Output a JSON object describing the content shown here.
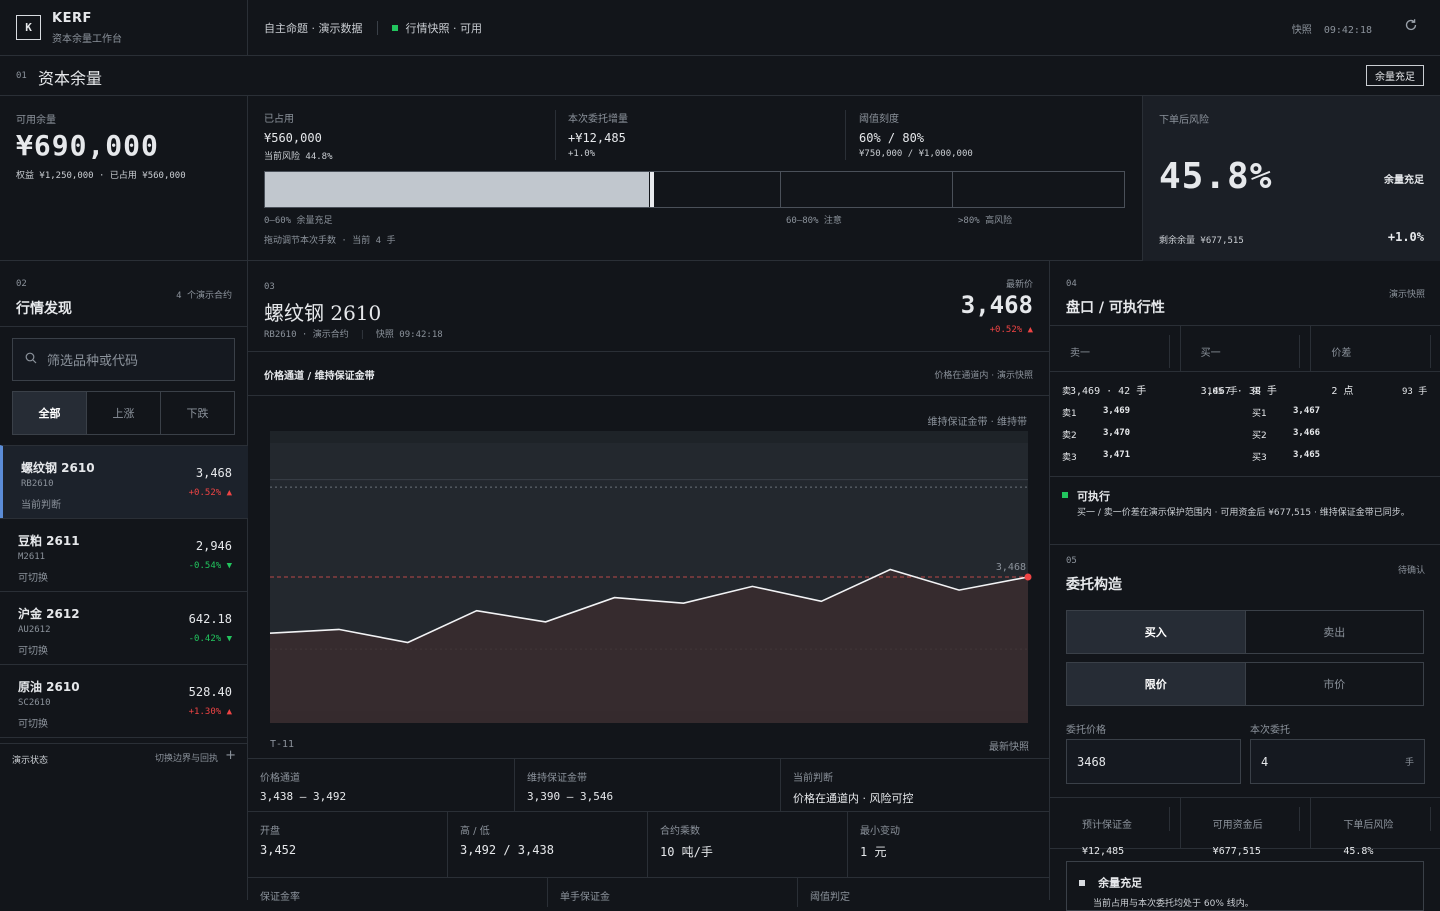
{
  "brand": {
    "logo": "K",
    "name": "KERF",
    "sub": "资本余量工作台"
  },
  "topbar": {
    "crumb_a": "自主命题 · 演示数据",
    "crumb_b": "行情快照 · 可用",
    "snap_label": "快照",
    "snap_time": "09:42:18",
    "refresh_icon": "refresh-icon"
  },
  "section1": {
    "num": "01",
    "title": "资本余量",
    "badge": "余量充足"
  },
  "capital": {
    "avail_label": "可用余量",
    "avail_value": "¥690,000",
    "avail_sub": "权益 ¥1,250,000 · 已占用 ¥560,000",
    "used_label": "已占用",
    "used_value": "¥560,000",
    "used_sub": "当前风险 44.8%",
    "inc_label": "本次委托增量",
    "inc_value": "+¥12,485",
    "inc_sub": "+1.0%",
    "thr_label": "阈值刻度",
    "thr_value": "60% / 80%",
    "thr_sub": "¥750,000 / ¥1,000,000",
    "bar_fill_pct": 44.8,
    "bar_lbl_a": "0–60% 余量充足",
    "bar_lbl_b": "60–80% 注意",
    "bar_lbl_c": ">80% 高风险",
    "drag_hint": "拖动调节本次手数 · 当前 4 手",
    "post_label": "下单后风险",
    "post_value": "45.8%",
    "post_status": "余量充足",
    "remain": "剩余余量 ¥677,515",
    "post_delta": "+1.0%"
  },
  "watch": {
    "num": "02",
    "title": "行情发现",
    "count": "4 个演示合约",
    "search_placeholder": "筛选品种或代码",
    "filters": [
      "全部",
      "上涨",
      "下跌"
    ],
    "items": [
      {
        "name": "螺纹钢 2610",
        "code": "RB2610",
        "state": "当前判断",
        "price": "3,468",
        "chg": "+0.52% ▲",
        "dir": "up"
      },
      {
        "name": "豆粕 2611",
        "code": "M2611",
        "state": "可切换",
        "price": "2,946",
        "chg": "-0.54% ▼",
        "dir": "down"
      },
      {
        "name": "沪金 2612",
        "code": "AU2612",
        "state": "可切换",
        "price": "642.18",
        "chg": "-0.42% ▼",
        "dir": "down"
      },
      {
        "name": "原油 2610",
        "code": "SC2610",
        "state": "可切换",
        "price": "528.40",
        "chg": "+1.30% ▲",
        "dir": "up"
      }
    ],
    "demo_label": "演示状态",
    "demo_action": "切换边界与回执"
  },
  "instrument": {
    "num": "03",
    "name": "螺纹钢 2610",
    "meta_a": "RB2610 · 演示合约",
    "meta_b": "快照 09:42:18",
    "last_label": "最新价",
    "last_price": "3,468",
    "last_chg": "+0.52% ▲",
    "panel_title": "价格通道 / 维持保证金带",
    "panel_note": "价格在通道内 · 演示快照",
    "legend": "维持保证金带 · 维持带",
    "x_start": "T-11",
    "x_end": "最新快照",
    "last_tag": "3,468"
  },
  "chart_data": {
    "type": "line",
    "x": [
      "T-11",
      "T-10",
      "T-9",
      "T-8",
      "T-7",
      "T-6",
      "T-5",
      "T-4",
      "T-3",
      "T-2",
      "T-1",
      "最新快照"
    ],
    "values": [
      3438,
      3440,
      3433,
      3450,
      3444,
      3457,
      3454,
      3463,
      3455,
      3472,
      3461,
      3468
    ],
    "channel": [
      3438,
      3492
    ],
    "margin_band": [
      3390,
      3546
    ],
    "ylim": [
      3390,
      3546
    ]
  },
  "stats": {
    "row1": [
      {
        "label": "价格通道",
        "value": "3,438 — 3,492"
      },
      {
        "label": "维持保证金带",
        "value": "3,390 — 3,546"
      },
      {
        "label": "当前判断",
        "value": "价格在通道内 · 风险可控"
      }
    ],
    "row2": [
      {
        "label": "开盘",
        "value": "3,452"
      },
      {
        "label": "高 / 低",
        "value": "3,492 / 3,438"
      },
      {
        "label": "合约乘数",
        "value": "10 吨/手"
      },
      {
        "label": "最小变动",
        "value": "1 元"
      }
    ],
    "row3": [
      {
        "label": "保证金率"
      },
      {
        "label": "单手保证金"
      },
      {
        "label": "阈值判定"
      }
    ]
  },
  "book": {
    "num": "04",
    "title": "盘口 / 可执行性",
    "note": "演示快照",
    "ask1_label": "卖一",
    "ask1": "3,469 · 42 手",
    "bid1_label": "买一",
    "bid1": "3,467 · 38 手",
    "spread_label": "价差",
    "spread": "2 点",
    "ask_head": "卖",
    "ask_total": "105 手",
    "bid_head": "买",
    "bid_total": "93 手",
    "asks": [
      {
        "l": "卖1",
        "p": "3,469"
      },
      {
        "l": "卖2",
        "p": "3,470"
      },
      {
        "l": "卖3",
        "p": "3,471"
      }
    ],
    "bids": [
      {
        "l": "买1",
        "p": "3,467"
      },
      {
        "l": "买2",
        "p": "3,466"
      },
      {
        "l": "买3",
        "p": "3,465"
      }
    ],
    "exec_title": "可执行",
    "exec_text": "买一 / 卖一价差在演示保护范围内 · 可用资金后 ¥677,515 · 维持保证金带已同步。"
  },
  "order": {
    "num": "05",
    "title": "委托构造",
    "status": "待确认",
    "side": [
      "买入",
      "卖出"
    ],
    "type": [
      "限价",
      "市价"
    ],
    "price_label": "委托价格",
    "price": "3468",
    "qty_label": "本次委托",
    "qty": "4",
    "qty_unit": "手",
    "est_margin_label": "预计保证金",
    "est_margin": "¥12,485",
    "avail_after_label": "可用资金后",
    "avail_after": "¥677,515",
    "risk_after_label": "下单后风险",
    "risk_after": "45.8%",
    "ok_title": "余量充足",
    "ok_text": "当前占用与本次委托均处于 60% 线内。"
  }
}
